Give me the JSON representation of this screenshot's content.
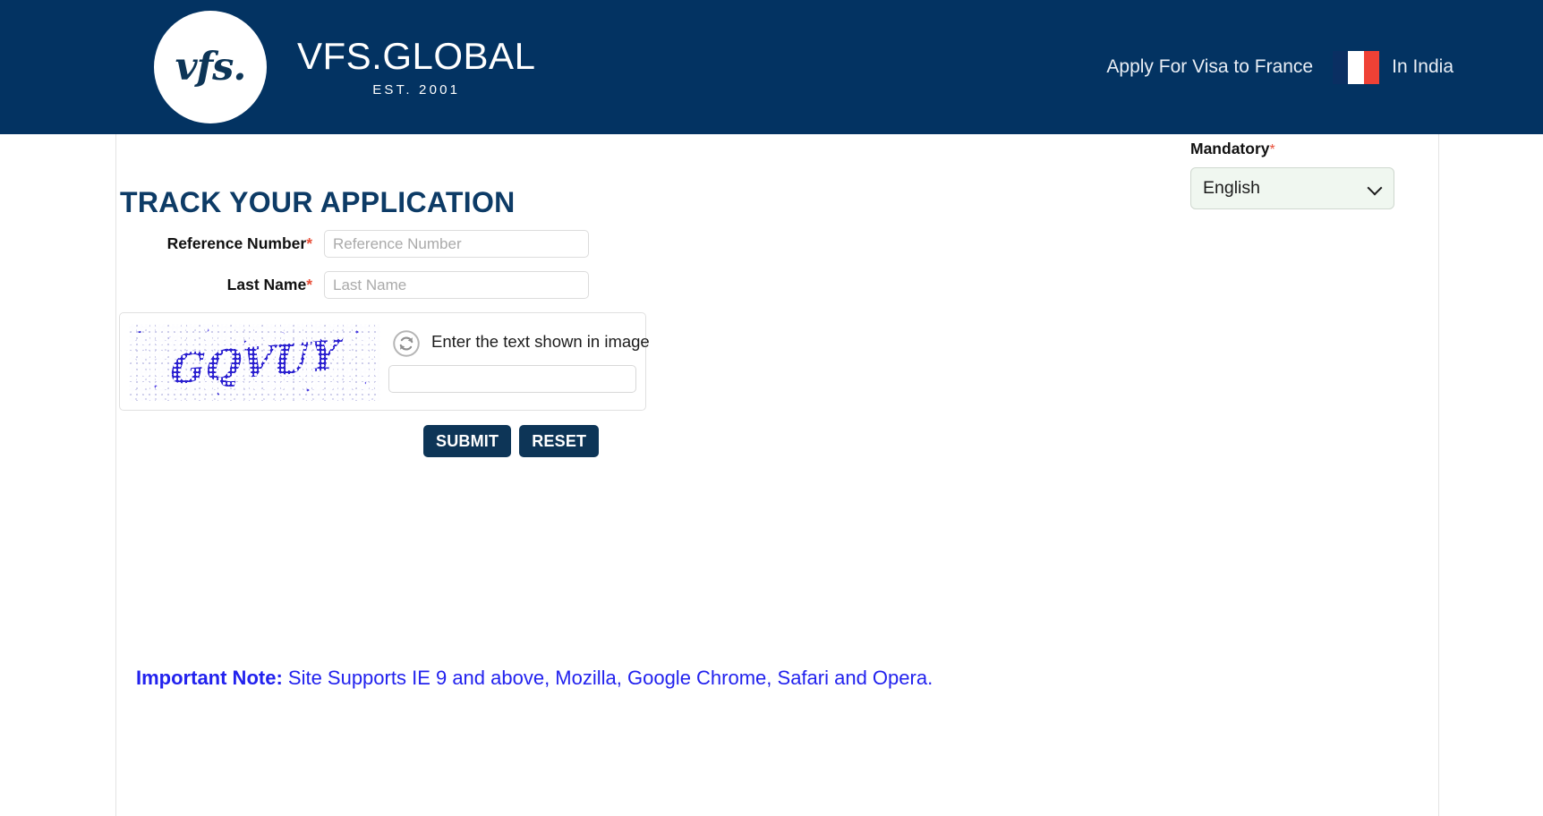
{
  "header": {
    "brand_mark": "vfs.",
    "brand_name": "VFS.GLOBAL",
    "brand_established": "EST. 2001",
    "apply_link": "Apply For Visa to France",
    "flag_icon": "france-flag-icon",
    "country": "In India",
    "background_color": "#033362"
  },
  "language": {
    "mandatory_label": "Mandatory",
    "required_marker": "*",
    "selected": "English",
    "options": [
      "English"
    ],
    "chevron_icon": "chevron-down-icon"
  },
  "main": {
    "title": "TRACK YOUR APPLICATION",
    "title_color": "#0d3b66",
    "fields": [
      {
        "label": "Reference Number",
        "required_marker": "*",
        "placeholder": "Reference Number",
        "value": ""
      },
      {
        "label": "Last Name",
        "required_marker": "*",
        "placeholder": "Last Name",
        "value": ""
      }
    ],
    "captcha": {
      "image_text": "GQVUY",
      "refresh_icon": "refresh-icon",
      "prompt": "Enter the text shown in image",
      "input_placeholder": "",
      "input_value": ""
    },
    "buttons": {
      "submit": "SUBMIT",
      "reset": "RESET",
      "color": "#0d3557"
    },
    "note": {
      "prefix": "Important Note:",
      "text": "Site Supports IE 9 and above, Mozilla, Google Chrome, Safari and Opera.",
      "color": "#2222ee"
    }
  }
}
